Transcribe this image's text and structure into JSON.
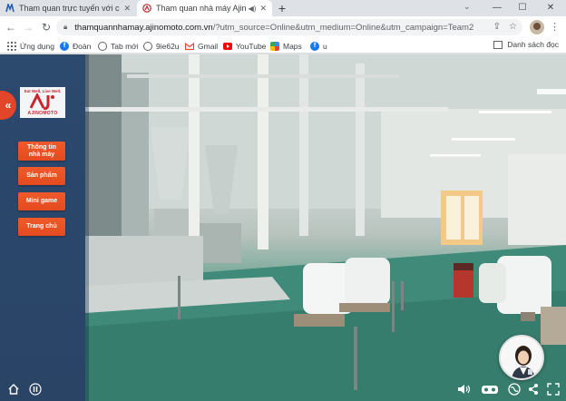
{
  "browser": {
    "tabs": [
      {
        "title": "Tham quan trực tuyến với công n",
        "active": false
      },
      {
        "title": "Tham quan nhà máy Ajinomo",
        "active": true
      }
    ],
    "address": {
      "host": "thamquannhamay.ajinomoto.com.vn",
      "path": "/?utm_source=Online&utm_medium=Online&utm_campaign=Team2"
    },
    "bookmarks": [
      {
        "label": "Ứng dụng",
        "icon": "apps-grid-icon",
        "color": "#5f6368"
      },
      {
        "label": "Đoàn",
        "icon": "facebook-icon",
        "color": "#1877f2"
      },
      {
        "label": "Tab mới",
        "icon": "globe-icon",
        "color": "#5f6368"
      },
      {
        "label": "9ie62u",
        "icon": "globe-icon",
        "color": "#5f6368"
      },
      {
        "label": "Gmail",
        "icon": "gmail-icon",
        "color": "#ea4335"
      },
      {
        "label": "YouTube",
        "icon": "youtube-icon",
        "color": "#ff0000"
      },
      {
        "label": "Maps",
        "icon": "maps-icon",
        "color": "#34a853"
      },
      {
        "label": "u",
        "icon": "facebook-icon",
        "color": "#1877f2"
      }
    ],
    "reading_list": "Danh sách đọc"
  },
  "page": {
    "logo": {
      "tagline": "Eat Well, Live Well.",
      "brand": "AJINOMOTO",
      "color": "#c9262d"
    },
    "menu": [
      {
        "line1": "Thông tin",
        "line2": "nhà máy"
      },
      {
        "line1": "Sản phẩm",
        "line2": ""
      },
      {
        "line1": "Mini game",
        "line2": ""
      },
      {
        "line1": "Trang chủ",
        "line2": ""
      }
    ],
    "accent": "#e8502a"
  }
}
